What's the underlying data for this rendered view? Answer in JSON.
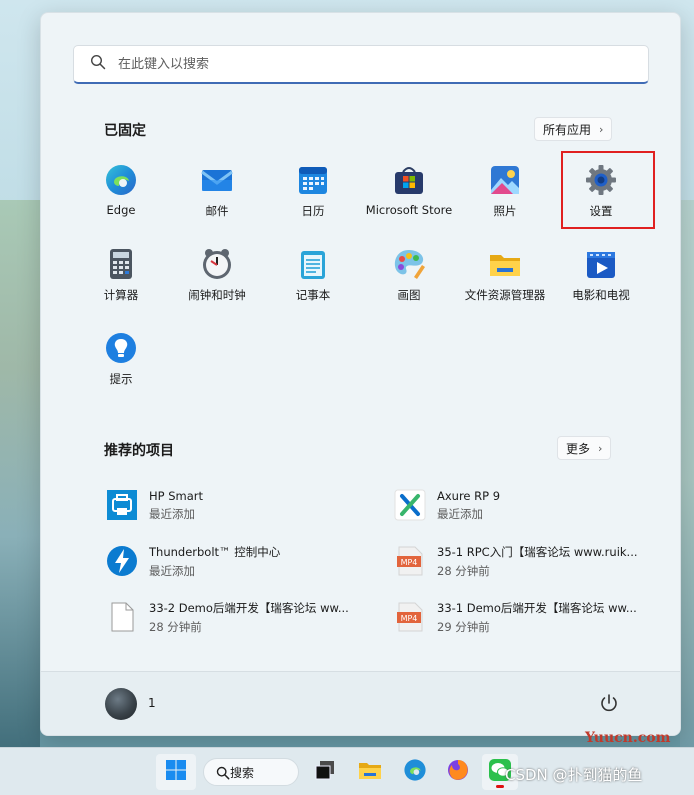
{
  "search": {
    "placeholder": "在此键入以搜索"
  },
  "pinned": {
    "title": "已固定",
    "all_apps_label": "所有应用",
    "apps": [
      {
        "label": "Edge",
        "icon": "edge-icon"
      },
      {
        "label": "邮件",
        "icon": "mail-icon"
      },
      {
        "label": "日历",
        "icon": "calendar-icon"
      },
      {
        "label": "Microsoft Store",
        "icon": "store-icon"
      },
      {
        "label": "照片",
        "icon": "photos-icon"
      },
      {
        "label": "设置",
        "icon": "gear-icon"
      },
      {
        "label": "计算器",
        "icon": "calculator-icon"
      },
      {
        "label": "闹钟和时钟",
        "icon": "clock-icon"
      },
      {
        "label": "记事本",
        "icon": "notepad-icon"
      },
      {
        "label": "画图",
        "icon": "paint-icon"
      },
      {
        "label": "文件资源管理器",
        "icon": "folder-icon"
      },
      {
        "label": "电影和电视",
        "icon": "movies-icon"
      },
      {
        "label": "提示",
        "icon": "tips-icon"
      }
    ]
  },
  "recommended": {
    "title": "推荐的项目",
    "more_label": "更多",
    "items": [
      {
        "name": "HP Smart",
        "sub": "最近添加",
        "icon": "hp-smart-icon"
      },
      {
        "name": "Axure RP 9",
        "sub": "最近添加",
        "icon": "axure-icon"
      },
      {
        "name": "Thunderbolt™ 控制中心",
        "sub": "最近添加",
        "icon": "thunderbolt-icon"
      },
      {
        "name": "35-1 RPC入门【瑞客论坛 www.ruik...",
        "sub": "28 分钟前",
        "icon": "mp4-icon"
      },
      {
        "name": "33-2 Demo后端开发【瑞客论坛 ww...",
        "sub": "28 分钟前",
        "icon": "file-icon"
      },
      {
        "name": "33-1 Demo后端开发【瑞客论坛 ww...",
        "sub": "29 分钟前",
        "icon": "mp4-icon"
      }
    ]
  },
  "user": {
    "name": "1"
  },
  "taskbar": {
    "search_label": "搜索"
  },
  "watermarks": {
    "site": "Yuucn.com",
    "csdn": "CSDN @扑到猫的鱼"
  },
  "colors": {
    "accent": "#3f6bb5",
    "highlight": "#e02020"
  }
}
